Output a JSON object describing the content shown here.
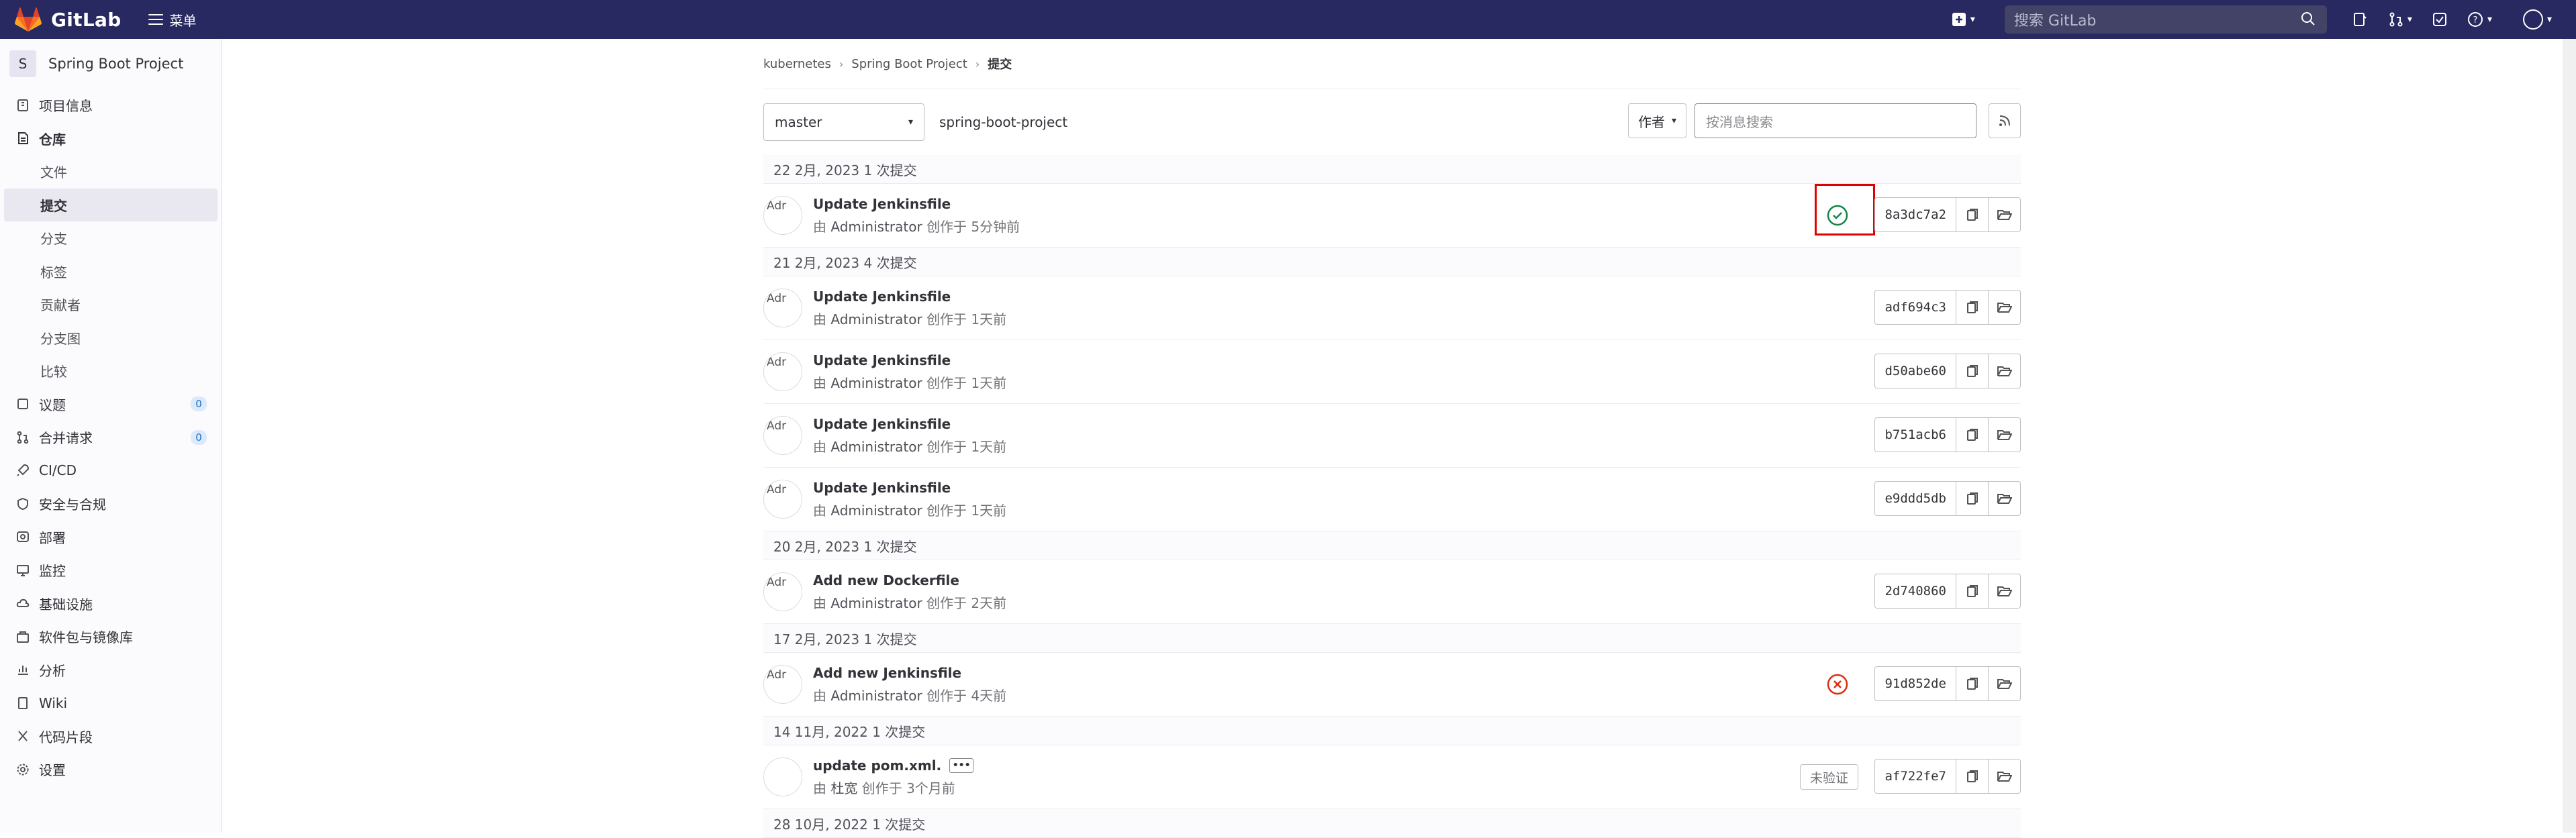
{
  "topbar": {
    "app_name": "GitLab",
    "menu_label": "菜单",
    "search_placeholder": "搜索 GitLab"
  },
  "sidebar": {
    "project_initial": "S",
    "project_name": "Spring Boot Project",
    "items": [
      {
        "label": "项目信息",
        "icon": "info-icon"
      },
      {
        "label": "仓库",
        "icon": "repository-icon"
      },
      {
        "label": "议题",
        "icon": "issues-icon",
        "count": "0"
      },
      {
        "label": "合并请求",
        "icon": "merge-request-icon",
        "count": "0"
      },
      {
        "label": "CI/CD",
        "icon": "rocket-icon"
      },
      {
        "label": "安全与合规",
        "icon": "shield-icon"
      },
      {
        "label": "部署",
        "icon": "deploy-icon"
      },
      {
        "label": "监控",
        "icon": "monitor-icon"
      },
      {
        "label": "基础设施",
        "icon": "cloud-icon"
      },
      {
        "label": "软件包与镜像库",
        "icon": "package-icon"
      },
      {
        "label": "分析",
        "icon": "chart-icon"
      },
      {
        "label": "Wiki",
        "icon": "book-icon"
      },
      {
        "label": "代码片段",
        "icon": "snippet-icon"
      },
      {
        "label": "设置",
        "icon": "gear-icon"
      }
    ],
    "repo_sub": [
      "文件",
      "提交",
      "分支",
      "标签",
      "贡献者",
      "分支图",
      "比较"
    ]
  },
  "breadcrumb": {
    "group": "kubernetes",
    "project": "Spring Boot Project",
    "current": "提交"
  },
  "filters": {
    "branch": "master",
    "path": "spring-boot-project",
    "author_label": "作者",
    "search_placeholder": "按消息搜索"
  },
  "days": [
    {
      "label": "22 2月, 2023 1 次提交"
    },
    {
      "label": "21 2月, 2023 4 次提交"
    },
    {
      "label": "20 2月, 2023 1 次提交"
    },
    {
      "label": "17 2月, 2023 1 次提交"
    },
    {
      "label": "14 11月, 2022 1 次提交"
    },
    {
      "label": "28 10月, 2022 1 次提交"
    }
  ],
  "commits": [
    {
      "title": "Update Jenkinsfile",
      "by": "由",
      "author": "Administrator",
      "time": "创作于 5分钟前",
      "sha": "8a3dc7a2",
      "avatar_alt": "Adr",
      "status": "success"
    },
    {
      "title": "Update Jenkinsfile",
      "by": "由",
      "author": "Administrator",
      "time": "创作于 1天前",
      "sha": "adf694c3",
      "avatar_alt": "Adr"
    },
    {
      "title": "Update Jenkinsfile",
      "by": "由",
      "author": "Administrator",
      "time": "创作于 1天前",
      "sha": "d50abe60",
      "avatar_alt": "Adr"
    },
    {
      "title": "Update Jenkinsfile",
      "by": "由",
      "author": "Administrator",
      "time": "创作于 1天前",
      "sha": "b751acb6",
      "avatar_alt": "Adr"
    },
    {
      "title": "Update Jenkinsfile",
      "by": "由",
      "author": "Administrator",
      "time": "创作于 1天前",
      "sha": "e9ddd5db",
      "avatar_alt": "Adr"
    },
    {
      "title": "Add new Dockerfile",
      "by": "由",
      "author": "Administrator",
      "time": "创作于 2天前",
      "sha": "2d740860",
      "avatar_alt": "Adr"
    },
    {
      "title": "Add new Jenkinsfile",
      "by": "由",
      "author": "Administrator",
      "time": "创作于 4天前",
      "sha": "91d852de",
      "avatar_alt": "Adr",
      "status": "failed"
    },
    {
      "title": "update pom.xml.",
      "by": "由",
      "author": "杜宽",
      "time": "创作于 3个月前",
      "sha": "af722fe7",
      "avatar_alt": "",
      "badge": "未验证"
    }
  ],
  "colors": {
    "topbar": "#292961",
    "success": "#108548",
    "failed": "#dd2b0e",
    "highlight": "#e10000"
  }
}
